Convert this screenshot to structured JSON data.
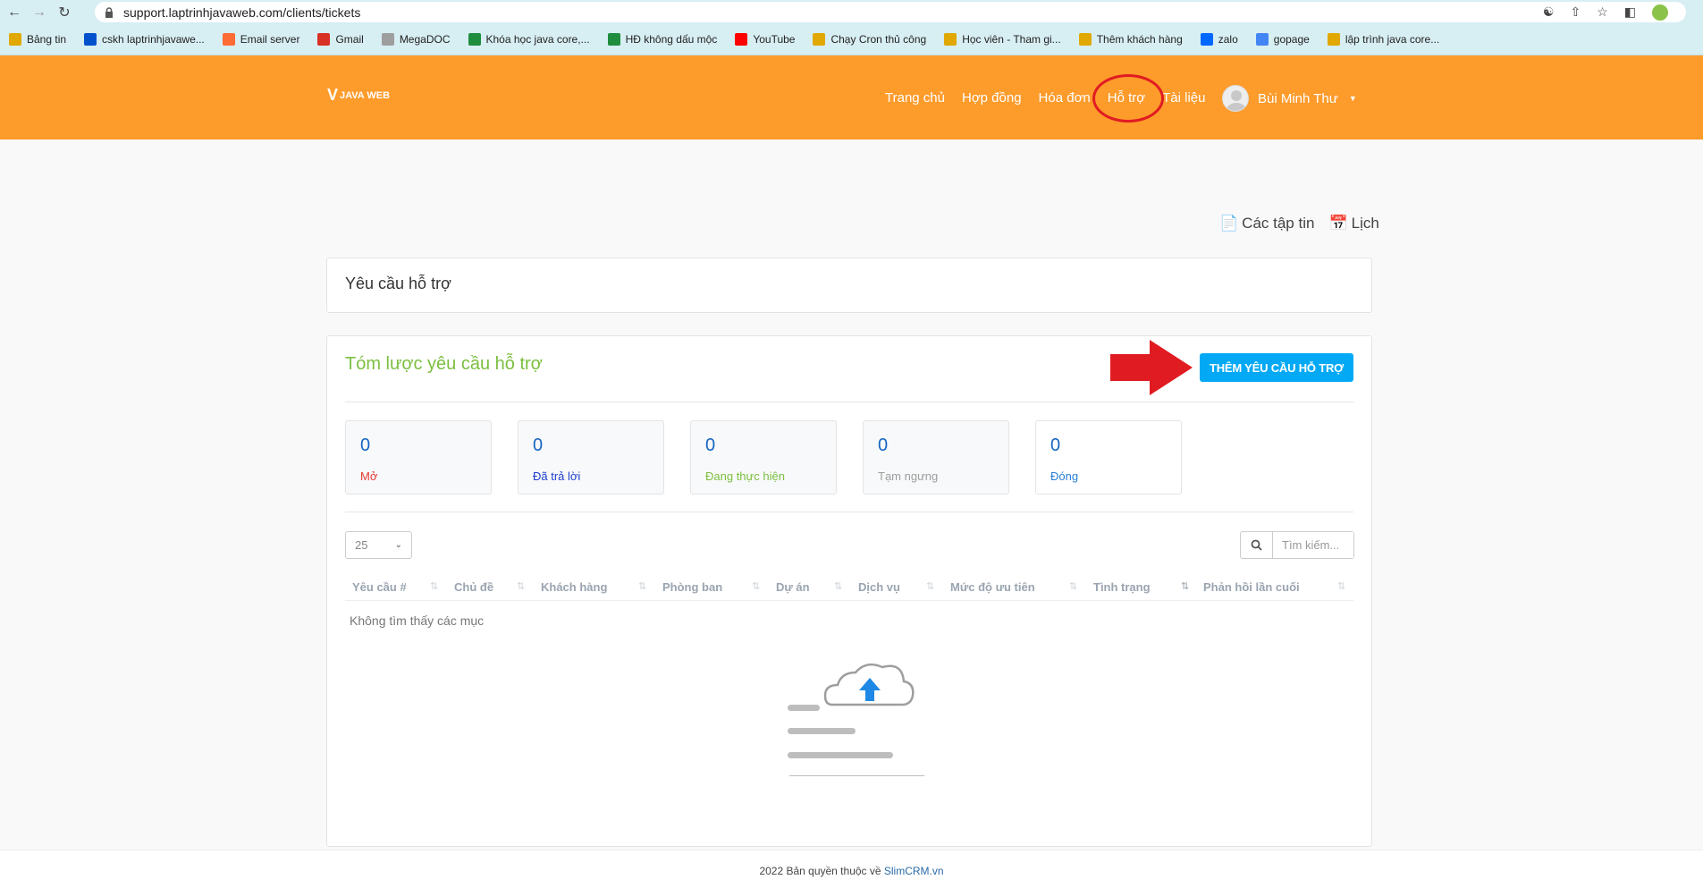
{
  "browser": {
    "url": "support.laptrinhjavaweb.com/clients/tickets",
    "bookmarks": [
      {
        "label": "Bảng tin",
        "color": "#e0a800"
      },
      {
        "label": "cskh laptrinhjavawe...",
        "color": "#0052cc"
      },
      {
        "label": "Email server",
        "color": "#ff6b35"
      },
      {
        "label": "Gmail",
        "color": "#d93025"
      },
      {
        "label": "MegaDOC",
        "color": "#9e9e9e"
      },
      {
        "label": "Khóa học java core,...",
        "color": "#1e8e3e"
      },
      {
        "label": "HĐ không dấu mộc",
        "color": "#1e8e3e"
      },
      {
        "label": "YouTube",
        "color": "#ff0000"
      },
      {
        "label": "Chạy Cron thủ công",
        "color": "#e0a800"
      },
      {
        "label": "Học viên - Tham gi...",
        "color": "#e0a800"
      },
      {
        "label": "Thêm khách hàng",
        "color": "#e0a800"
      },
      {
        "label": "zalo",
        "color": "#0068ff"
      },
      {
        "label": "gopage",
        "color": "#4285f4"
      },
      {
        "label": "lập trình java core...",
        "color": "#e0a800"
      }
    ]
  },
  "header": {
    "brand_color": "#fd9b2b",
    "logo_text": "JAVA WEB",
    "menu": [
      {
        "label": "Trang chủ"
      },
      {
        "label": "Hợp đồng"
      },
      {
        "label": "Hóa đơn"
      },
      {
        "label": "Hỗ trợ"
      },
      {
        "label": "Tài liệu"
      }
    ],
    "user_name": "Bùi Minh Thư"
  },
  "toplinks": {
    "files": "Các tập tin",
    "calendar": "Lịch"
  },
  "page_title": "Yêu cầu hỗ trợ",
  "summary": {
    "title": "Tóm lược yêu cầu hỗ trợ",
    "add_button": "THÊM YÊU CẦU HỖ TRỢ",
    "stats": [
      {
        "value": "0",
        "label": "Mở",
        "color": "#e53935"
      },
      {
        "value": "0",
        "label": "Đã trả lời",
        "color": "#1e3fd0"
      },
      {
        "value": "0",
        "label": "Đang thực hiện",
        "color": "#7cbf3f"
      },
      {
        "value": "0",
        "label": "Tạm ngưng",
        "color": "#9e9e9e"
      },
      {
        "value": "0",
        "label": "Đóng",
        "color": "#2a7fd4"
      }
    ]
  },
  "table": {
    "page_size": "25",
    "search_placeholder": "Tìm kiếm...",
    "columns": [
      "Yêu cầu #",
      "Chủ đề",
      "Khách hàng",
      "Phòng ban",
      "Dự án",
      "Dịch vụ",
      "Mức độ ưu tiên",
      "Tình trạng",
      "Phản hồi lần cuối"
    ],
    "empty_text": "Không tìm thấy các mục"
  },
  "footer": {
    "text": "2022 Bản quyền thuộc về",
    "link": "SlimCRM.vn"
  }
}
